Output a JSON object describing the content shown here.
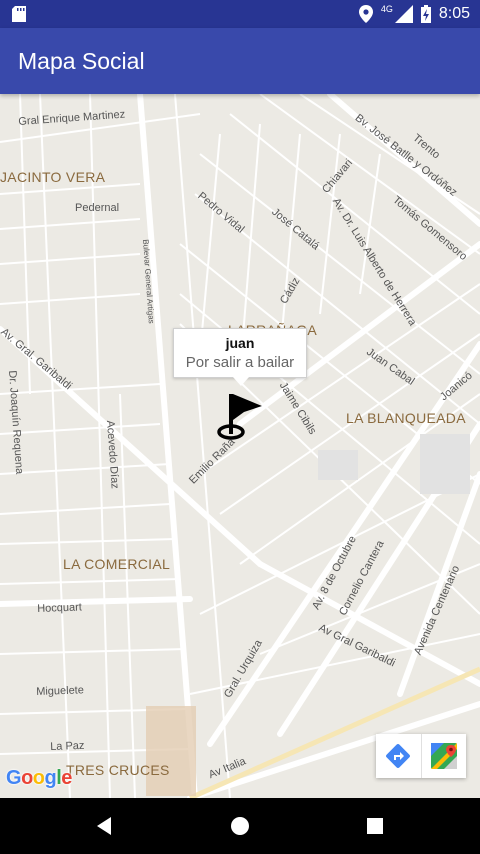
{
  "status_bar": {
    "time": "8:05",
    "network_label": "4G",
    "icons": [
      "sd-card-icon",
      "location-icon",
      "signal-icon",
      "battery-icon"
    ]
  },
  "app_bar": {
    "title": "Mapa Social",
    "color": "#3949ab",
    "status_color": "#283593"
  },
  "map": {
    "streets": [
      "Gral Enrique Martinez",
      "Pedernal",
      "Bulevar General Artigas",
      "Av. Gral. Garibaldi",
      "Dr. Joaquín Requena",
      "Acevedo Díaz",
      "Hocquart",
      "Miguelete",
      "La Paz",
      "Pedro Vidal",
      "José Catalá",
      "Chiavari",
      "Av. Dr. Luis Alberto de Herrera",
      "Bv. José Batlle y Ordóñez",
      "Trento",
      "Tomás Gomensoro",
      "Cádiz",
      "Juan Cabal",
      "Joanicó",
      "Jaime Cibils",
      "Emilio Raña",
      "Av. 8 de Octubre",
      "Cornelio Cantera",
      "Av Gral Garibaldi",
      "Avenida Centenario",
      "Gral. Urquiza",
      "Av Italia"
    ],
    "neighborhoods": [
      "JACINTO VERA",
      "LARRAÑAGA",
      "LA BLANQUEADA",
      "LA COMERCIAL",
      "TRES CRUCES"
    ],
    "attribution": "Google"
  },
  "info_window": {
    "title": "juan",
    "snippet": "Por salir a bailar"
  },
  "map_toolbar": {
    "directions_icon": "directions-icon",
    "maps_icon": "google-maps-icon"
  },
  "nav_bar": {
    "buttons": [
      "back-icon",
      "home-icon",
      "recents-icon"
    ]
  }
}
